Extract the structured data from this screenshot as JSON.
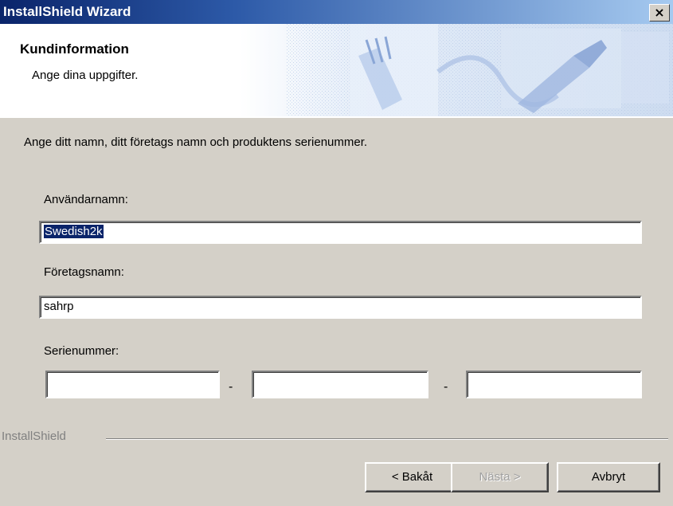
{
  "window": {
    "title": "InstallShield Wizard",
    "close_glyph": "×"
  },
  "header": {
    "title": "Kundinformation",
    "subtitle": "Ange dina uppgifter.",
    "banner_icon": "banner-decoration-icon"
  },
  "body": {
    "instruction": "Ange ditt namn, ditt företags namn och  produktens serienummer.",
    "username": {
      "label": "Användarnamn:",
      "value": "Swedish2k"
    },
    "company": {
      "label": "Företagsnamn:",
      "value": "sahrp"
    },
    "serial": {
      "label": "Serienummer:",
      "part1": "",
      "part2": "",
      "part3": "",
      "separator": "-"
    }
  },
  "footer": {
    "brand": "InstallShield",
    "back_label": "< Bakåt",
    "next_label": "Nästa >",
    "cancel_label": "Avbryt"
  },
  "colors": {
    "titlebar_start": "#0a246a",
    "titlebar_end": "#a6caf0",
    "dialog_bg": "#d4d0c8",
    "selection": "#0a246a"
  }
}
